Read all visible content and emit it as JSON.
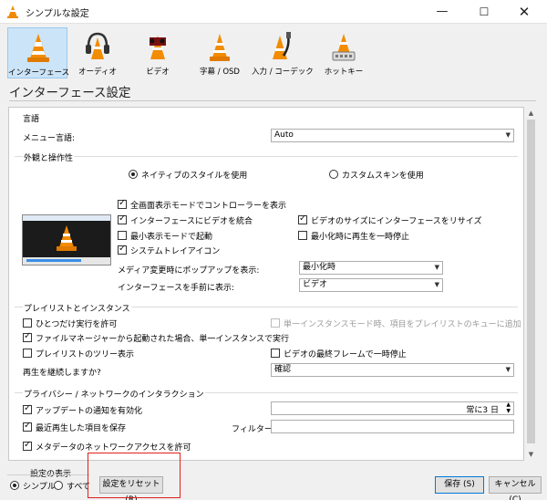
{
  "window": {
    "title": "シンプルな設定",
    "minimize_glyph": "—",
    "maximize_glyph": "☐",
    "close_glyph": "✕"
  },
  "categories": [
    {
      "label": "インターフェース",
      "icon": "vlc-cone-icon",
      "selected": true
    },
    {
      "label": "オーディオ",
      "icon": "headphones-icon"
    },
    {
      "label": "ビデオ",
      "icon": "film-icon"
    },
    {
      "label": "字幕 / OSD",
      "icon": "subtitles-cone-icon"
    },
    {
      "label": "入力 / コーデック",
      "icon": "input-codec-icon"
    },
    {
      "label": "ホットキー",
      "icon": "hotkeys-icon"
    }
  ],
  "page_title": "インターフェース設定",
  "language": {
    "section_title": "言語",
    "menu_language_label": "メニュー言語:",
    "menu_language_value": "Auto"
  },
  "appearance": {
    "section_title": "外観と操作性",
    "radio_native": "ネイティブのスタイルを使用",
    "radio_custom": "カスタムスキンを使用",
    "cb_fullscreen_controller": "全画面表示モードでコントローラーを表示",
    "cb_embed_video": "インターフェースにビデオを統合",
    "cb_resize_to_video": "ビデオのサイズにインターフェースをリサイズ",
    "cb_minimal_mode": "最小表示モードで起動",
    "cb_pause_minimized": "最小化時に再生を一時停止",
    "cb_systray": "システムトレイアイコン",
    "popup_label": "メディア変更時にポップアップを表示:",
    "popup_value": "最小化時",
    "raise_label": "インターフェースを手前に表示:",
    "raise_value": "ビデオ"
  },
  "playlist": {
    "section_title": "プレイリストとインスタンス",
    "cb_one_instance": "ひとつだけ実行を許可",
    "cb_one_instance_queue": "単一インスタンスモード時、項目をプレイリストのキューに追加",
    "cb_file_manager_instance": "ファイルマネージャーから起動された場合、単一インスタンスで実行",
    "cb_tree_view": "プレイリストのツリー表示",
    "cb_pause_last_frame": "ビデオの最終フレームで一時停止",
    "continue_label": "再生を継続しますか?",
    "continue_value": "確認"
  },
  "privacy": {
    "section_title": "プライバシー / ネットワークのインタラクション",
    "cb_update_notify": "アップデートの通知を有効化",
    "update_interval_value": "常に3 日",
    "cb_save_recent": "最近再生した項目を保存",
    "filter_label": "フィルター:",
    "filter_value": "",
    "cb_metadata_network": "メタデータのネットワークアクセスを許可"
  },
  "bottom": {
    "show_settings_label": "設定の表示",
    "radio_simple": "シンプル",
    "radio_all": "すべて",
    "reset_button": "設定をリセット (R)",
    "save_button": "保存 (S)",
    "cancel_button": "キャンセル (C)"
  }
}
